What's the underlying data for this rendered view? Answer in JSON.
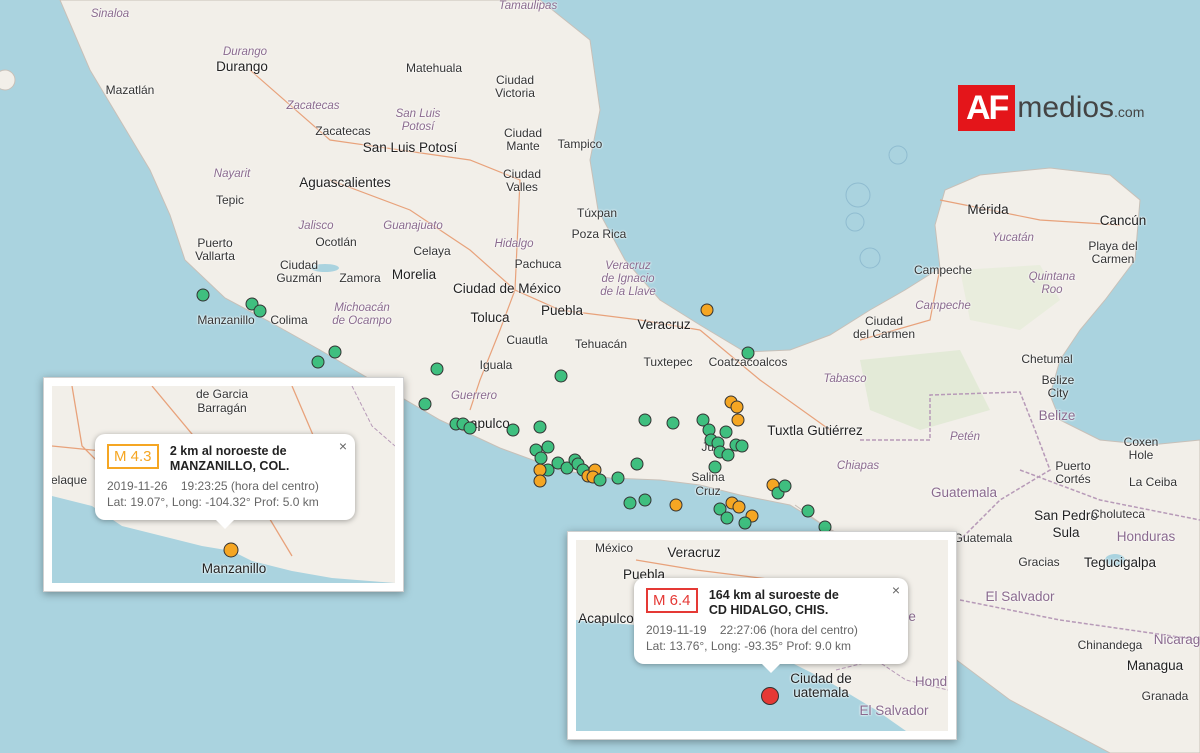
{
  "logo": {
    "badge": "AF",
    "text": "medios",
    "suffix": ".com"
  },
  "places": {
    "sinaloa": "Sinaloa",
    "tamaulipas": "Tamaulipas",
    "durango_state": "Durango",
    "durango": "Durango",
    "matehuala": "Matehuala",
    "ciudad_victoria_1": "Ciudad",
    "ciudad_victoria_2": "Victoria",
    "mazatlan": "Mazatlán",
    "zacatecas_state": "Zacatecas",
    "san_luis_state_1": "San Luis",
    "san_luis_state_2": "Potosí",
    "ciudad_mante_1": "Ciudad",
    "ciudad_mante_2": "Mante",
    "tampico": "Tampico",
    "zacatecas": "Zacatecas",
    "san_luis_potosi": "San Luis Potosí",
    "nayarit": "Nayarit",
    "aguascalientes": "Aguascalientes",
    "ciudad_valles_1": "Ciudad",
    "ciudad_valles_2": "Valles",
    "tepic": "Tepic",
    "jalisco": "Jalisco",
    "guanajuato": "Guanajuato",
    "tuxpan": "Túxpan",
    "merida": "Mérida",
    "cancun": "Cancún",
    "puerto_vallarta_1": "Puerto",
    "puerto_vallarta_2": "Vallarta",
    "ocotlan": "Ocotlán",
    "celaya": "Celaya",
    "hidalgo": "Hidalgo",
    "poza_rica": "Poza Rica",
    "yucatan": "Yucatán",
    "playa_1": "Playa del",
    "playa_2": "Carmen",
    "guzman_1": "Ciudad",
    "guzman_2": "Guzmán",
    "zamora": "Zamora",
    "morelia": "Morelia",
    "pachuca": "Pachuca",
    "veracruz_state_1": "Veracruz",
    "veracruz_state_2": "de Ignacio",
    "veracruz_state_3": "de la Llave",
    "campeche": "Campeche",
    "quintana_1": "Quintana",
    "quintana_2": "Roo",
    "michoacan_1": "Michoacán",
    "michoacan_2": "de Ocampo",
    "cdmx": "Ciudad de México",
    "manzanillo": "Manzanillo",
    "colima": "Colima",
    "toluca": "Toluca",
    "puebla": "Puebla",
    "veracruz": "Veracruz",
    "campeche_state": "Campeche",
    "ciudad_carmen_1": "Ciudad",
    "ciudad_carmen_2": "del Carmen",
    "cuautla": "Cuautla",
    "tehuacan": "Tehuacán",
    "iguala": "Iguala",
    "tuxtepec": "Tuxtepec",
    "coatzacoalcos": "Coatzacoalcos",
    "tabasco": "Tabasco",
    "chetumal": "Chetumal",
    "belize_city_1": "Belize",
    "belize_city_2": "City",
    "belize": "Belize",
    "guerrero": "Guerrero",
    "acapulco": "Acapulco",
    "tuxtla": "Tuxtla Gutiérrez",
    "peten": "Petén",
    "coxen_1": "Coxen",
    "coxen_2": "Hole",
    "juchitan": "Jucl",
    "chiapas": "Chiapas",
    "puerto_cortes_1": "Puerto",
    "puerto_cortes_2": "Cortés",
    "la_ceiba": "La Ceiba",
    "salina_cruz_1": "Salina",
    "salina_cruz_2": "Cruz",
    "guatemala_country": "Guatemala",
    "san_pedro_1": "San Pedro",
    "san_pedro_2": "Sula",
    "honduras": "Honduras",
    "guatemala_city": "Guatemala",
    "choluteca": "Choluteca",
    "gracias": "Gracias",
    "tegucigalpa": "Tegucigalpa",
    "el_salvador": "El Salvador",
    "nicaragua": "Nicarag",
    "chinandega": "Chinandega",
    "managua": "Managua",
    "granada": "Granada"
  },
  "inset_left": {
    "labels": {
      "garcia_1": "de Garcia",
      "garcia_2": "Barragán",
      "melaque": "Melaque",
      "manzanillo": "Manzanillo"
    },
    "popup": {
      "magnitude": "M 4.3",
      "location_line1": "2 km al noroeste de",
      "location_line2": "MANZANILLO, COL.",
      "date": "2019-11-26",
      "time": "19:23:25 (hora del centro)",
      "coords": "Lat: 19.07°, Long: -104.32°  Prof: 5.0 km",
      "close": "×"
    }
  },
  "inset_right": {
    "labels": {
      "mexico": "México",
      "veracruz": "Veracruz",
      "puebla": "Puebla",
      "acapulco": "Acapulco",
      "belize": "elize",
      "ciudad_gt_1": "Ciudad de",
      "ciudad_gt_2": "uatemala",
      "honduras": "Hond",
      "el_salvador": "El Salvador"
    },
    "popup": {
      "magnitude": "M 6.4",
      "location_line1": "164 km al suroeste de",
      "location_line2": "CD HIDALGO, CHIS.",
      "date": "2019-11-19",
      "time": "22:27:06 (hora del centro)",
      "coords": "Lat: 13.76°, Long: -93.35°  Prof: 9.0 km",
      "close": "×"
    }
  },
  "colors": {
    "water": "#aad3df",
    "land": "#f2efe9",
    "quake_green": "#3fbf7f",
    "quake_orange": "#f5a623",
    "quake_red": "#e53935",
    "brand_red": "#e4151a"
  }
}
